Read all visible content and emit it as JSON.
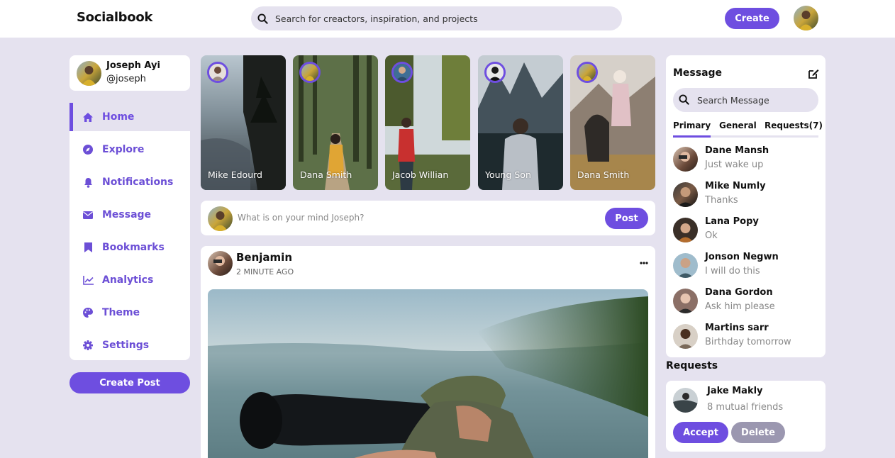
{
  "colors": {
    "accent": "#6e4ee0",
    "background": "#e5e2ef",
    "delete": "#9b97b0"
  },
  "header": {
    "logo": "Socialbook",
    "search_placeholder": "Search for creactors, inspiration, and projects",
    "create_label": "Create",
    "icons": [
      "search-icon",
      "user-avatar"
    ]
  },
  "profile": {
    "name": "Joseph Ayi",
    "handle": "@joseph"
  },
  "sidebar": {
    "items": [
      {
        "label": "Home",
        "icon": "home-icon",
        "active": true
      },
      {
        "label": "Explore",
        "icon": "compass-icon"
      },
      {
        "label": "Notifications",
        "icon": "bell-icon"
      },
      {
        "label": "Message",
        "icon": "envelope-icon"
      },
      {
        "label": "Bookmarks",
        "icon": "bookmark-icon"
      },
      {
        "label": "Analytics",
        "icon": "chart-line-icon"
      },
      {
        "label": "Theme",
        "icon": "palette-icon"
      },
      {
        "label": "Settings",
        "icon": "gear-icon"
      }
    ],
    "create_post_label": "Create Post"
  },
  "stories": [
    {
      "name": "Mike Edourd"
    },
    {
      "name": "Dana Smith"
    },
    {
      "name": "Jacob Willian"
    },
    {
      "name": "Young Son"
    },
    {
      "name": "Dana Smith"
    }
  ],
  "composer": {
    "placeholder": "What is on your mind Joseph?",
    "post_label": "Post"
  },
  "feed": {
    "post": {
      "author": "Benjamin",
      "time": "2 MINUTE AGO",
      "more_icon": "ellipsis-icon"
    }
  },
  "messages": {
    "title": "Message",
    "edit_icon": "edit-icon",
    "search_placeholder": "Search Message",
    "tabs": [
      {
        "label": "Primary",
        "active": true
      },
      {
        "label": "General"
      },
      {
        "label": "Requests(7)"
      }
    ],
    "list": [
      {
        "name": "Dane Mansh",
        "text": "Just wake up"
      },
      {
        "name": "Mike Numly",
        "text": "Thanks"
      },
      {
        "name": "Lana Popy",
        "text": "Ok"
      },
      {
        "name": "Jonson Negwn",
        "text": "I will do this"
      },
      {
        "name": "Dana Gordon",
        "text": "Ask him please"
      },
      {
        "name": "Martins sarr",
        "text": "Birthday tomorrow"
      }
    ]
  },
  "requests": {
    "title": "Requests",
    "item": {
      "name": "Jake Makly",
      "sub": "8 mutual friends"
    },
    "accept_label": "Accept",
    "delete_label": "Delete"
  }
}
